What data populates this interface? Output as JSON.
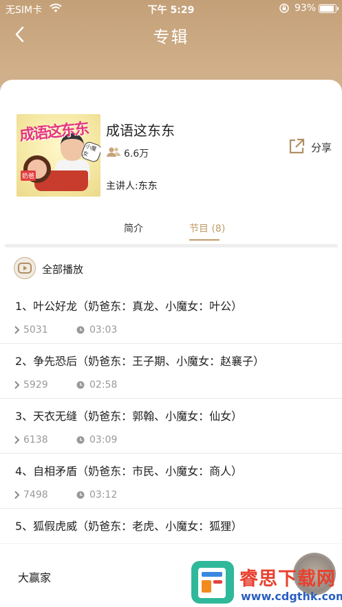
{
  "status_bar": {
    "carrier": "无SIM卡",
    "time": "下午 5:29",
    "battery": "93%",
    "battery_level": 0.93
  },
  "nav": {
    "title": "专辑",
    "back_icon": "chevron-left-icon"
  },
  "album": {
    "cover_text": "成语这东东",
    "cover_tags": [
      "奶爸",
      "小魔女"
    ],
    "title": "成语这东东",
    "listeners": "6.6万",
    "speaker": "主讲人:东东",
    "share_label": "分享"
  },
  "tabs": [
    {
      "label": "简介",
      "active": false
    },
    {
      "label": "节目 (8)",
      "active": true
    }
  ],
  "play_all_label": "全部播放",
  "episodes": [
    {
      "title": "1、叶公好龙（奶爸东：真龙、小魔女：叶公）",
      "plays": "5031",
      "duration": "03:03"
    },
    {
      "title": "2、争先恐后（奶爸东：王子期、小魔女：赵襄子）",
      "plays": "5929",
      "duration": "02:58"
    },
    {
      "title": "3、天衣无缝（奶爸东：郭翰、小魔女：仙女）",
      "plays": "6138",
      "duration": "03:09"
    },
    {
      "title": "4、自相矛盾（奶爸东：市民、小魔女：商人）",
      "plays": "7498",
      "duration": "03:12"
    },
    {
      "title": "5、狐假虎威（奶爸东：老虎、小魔女：狐狸）",
      "plays": "",
      "duration": ""
    }
  ],
  "bottom_bar": {
    "label": "大赢家"
  },
  "watermark": {
    "name": "睿思下载网",
    "url": "www.cdgthk.com"
  },
  "colors": {
    "header": "#c9a67e",
    "accent": "#c09a68",
    "watermark_red": "#e8412f",
    "watermark_blue": "#2a5fc1"
  }
}
